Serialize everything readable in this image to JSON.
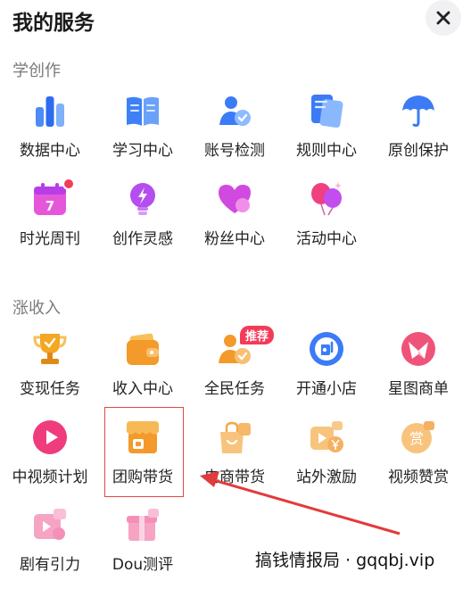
{
  "header": {
    "title": "我的服务",
    "close_icon": "close-icon"
  },
  "sections": [
    {
      "title": "学创作",
      "items": [
        {
          "label": "数据中心",
          "icon": "bar-chart-icon"
        },
        {
          "label": "学习中心",
          "icon": "open-book-icon"
        },
        {
          "label": "账号检测",
          "icon": "user-check-icon"
        },
        {
          "label": "规则中心",
          "icon": "documents-icon"
        },
        {
          "label": "原创保护",
          "icon": "umbrella-icon"
        },
        {
          "label": "时光周刊",
          "icon": "calendar-icon",
          "calendar_day": "7",
          "has_dot": true
        },
        {
          "label": "创作灵感",
          "icon": "lightbulb-icon"
        },
        {
          "label": "粉丝中心",
          "icon": "heart-icon"
        },
        {
          "label": "活动中心",
          "icon": "balloons-icon"
        }
      ]
    },
    {
      "title": "涨收入",
      "items": [
        {
          "label": "变现任务",
          "icon": "trophy-icon"
        },
        {
          "label": "收入中心",
          "icon": "wallet-icon"
        },
        {
          "label": "全民任务",
          "icon": "task-check-icon",
          "badge": "推荐"
        },
        {
          "label": "开通小店",
          "icon": "shop-icon"
        },
        {
          "label": "星图商单",
          "icon": "star-map-icon"
        },
        {
          "label": "中视频计划",
          "icon": "play-icon"
        },
        {
          "label": "团购带货",
          "icon": "storefront-icon"
        },
        {
          "label": "电商带货",
          "icon": "shopping-bag-icon"
        },
        {
          "label": "站外激励",
          "icon": "video-yuan-icon"
        },
        {
          "label": "视频赞赏",
          "icon": "tip-coin-icon",
          "coin_text": "赏"
        },
        {
          "label": "剧有引力",
          "icon": "drama-ticket-icon"
        },
        {
          "label": "Dou测评",
          "icon": "gift-box-icon"
        }
      ]
    }
  ],
  "annotation": {
    "watermark": "搞钱情报局 · gqqbj.vip"
  },
  "colors": {
    "accent_blue": "#3b7bf6",
    "accent_pink": "#ee3c8c",
    "accent_orange": "#f39a2a",
    "badge_red": "#f33b58"
  }
}
